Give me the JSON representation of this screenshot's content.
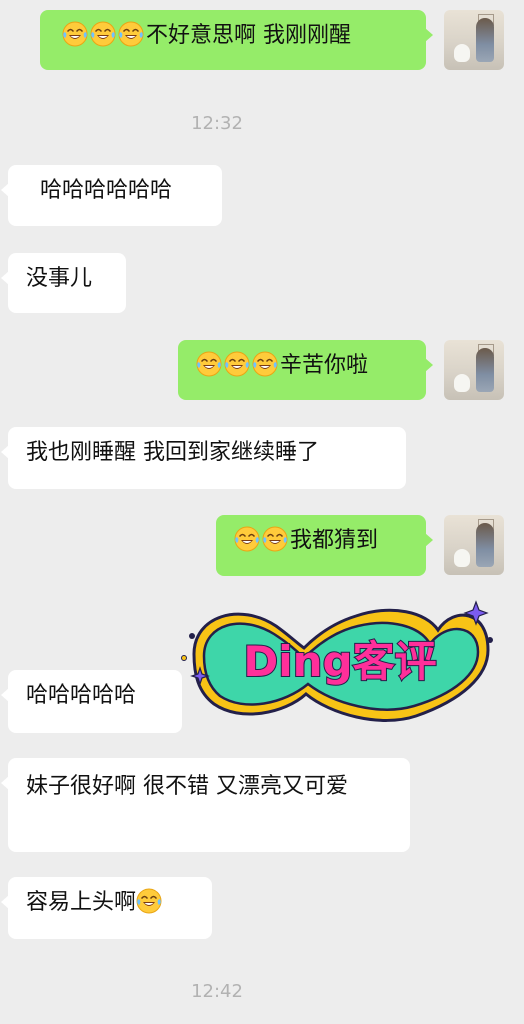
{
  "messages": {
    "m1": {
      "text": "不好意思啊 我刚刚醒",
      "emoji_count": 3,
      "emoji": "laughing-crying-face-icon"
    },
    "time1": "12:32",
    "m2": "哈哈哈哈哈哈",
    "m3": "没事儿",
    "m4": {
      "text": "辛苦你啦",
      "emoji_count": 3,
      "emoji": "laughing-crying-face-icon"
    },
    "m5": "我也刚睡醒 我回到家继续睡了",
    "m6": {
      "text": "我都猜到",
      "emoji_count": 2,
      "emoji": "laughing-crying-face-icon"
    },
    "m7": "哈哈哈哈哈",
    "m8": "妹子很好啊 很不错 又漂亮又可爱",
    "m9": {
      "text": "容易上头啊",
      "emoji": "laughing-crying-face-icon"
    },
    "time2": "12:42"
  },
  "sticker": {
    "text": "Ding客评"
  },
  "colors": {
    "background": "#ededed",
    "incoming_bubble": "#ffffff",
    "outgoing_bubble": "#95ec69",
    "timestamp": "#b2b2b2",
    "sticker_fill": "#3ed6a9",
    "sticker_text": "#ff2f9a",
    "sticker_outline": "#f8c316"
  }
}
